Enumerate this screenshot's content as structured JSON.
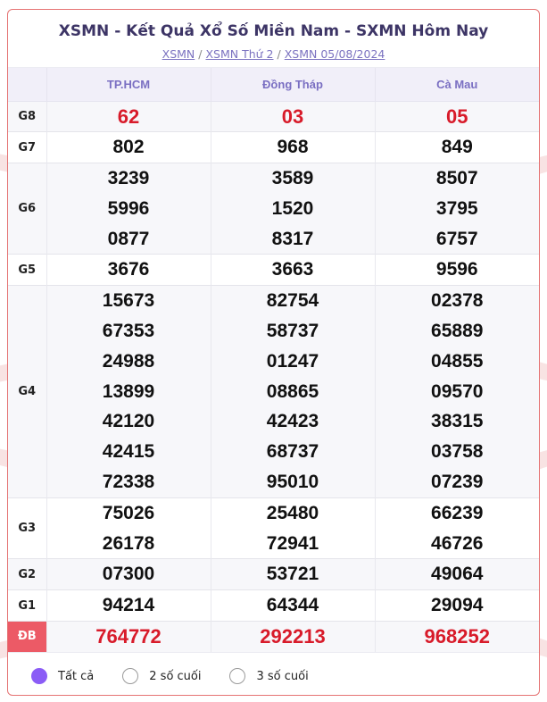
{
  "title": "XSMN - Kết Quả Xổ Số Miền Nam - SXMN Hôm Nay",
  "breadcrumb": [
    "XSMN",
    "XSMN Thứ 2",
    "XSMN 05/08/2024"
  ],
  "breadcrumb_separator": "/",
  "provinces": [
    "TP.HCM",
    "Đồng Tháp",
    "Cà Mau"
  ],
  "prizes": [
    {
      "label": "G8",
      "rows": [
        [
          "62",
          "03",
          "05"
        ]
      ]
    },
    {
      "label": "G7",
      "rows": [
        [
          "802",
          "968",
          "849"
        ]
      ]
    },
    {
      "label": "G6",
      "rows": [
        [
          "3239",
          "3589",
          "8507"
        ],
        [
          "5996",
          "1520",
          "3795"
        ],
        [
          "0877",
          "8317",
          "6757"
        ]
      ]
    },
    {
      "label": "G5",
      "rows": [
        [
          "3676",
          "3663",
          "9596"
        ]
      ]
    },
    {
      "label": "G4",
      "rows": [
        [
          "15673",
          "82754",
          "02378"
        ],
        [
          "67353",
          "58737",
          "65889"
        ],
        [
          "24988",
          "01247",
          "04855"
        ],
        [
          "13899",
          "08865",
          "09570"
        ],
        [
          "42120",
          "42423",
          "38315"
        ],
        [
          "42415",
          "68737",
          "03758"
        ],
        [
          "72338",
          "95010",
          "07239"
        ]
      ]
    },
    {
      "label": "G3",
      "rows": [
        [
          "75026",
          "25480",
          "66239"
        ],
        [
          "26178",
          "72941",
          "46726"
        ]
      ]
    },
    {
      "label": "G2",
      "rows": [
        [
          "07300",
          "53721",
          "49064"
        ]
      ]
    },
    {
      "label": "G1",
      "rows": [
        [
          "94214",
          "64344",
          "29094"
        ]
      ]
    },
    {
      "label": "ĐB",
      "rows": [
        [
          "764772",
          "292213",
          "968252"
        ]
      ]
    }
  ],
  "display_options": {
    "items": [
      "Tất cả",
      "2 số cuối",
      "3 số cuối"
    ],
    "selected": "Tất cả"
  },
  "colors": {
    "accent": "#8b5cf6",
    "prize_red": "#d81b2a",
    "special_label_bg": "#ec5a66",
    "header_bg": "#f1eff9",
    "border": "#e57373"
  }
}
